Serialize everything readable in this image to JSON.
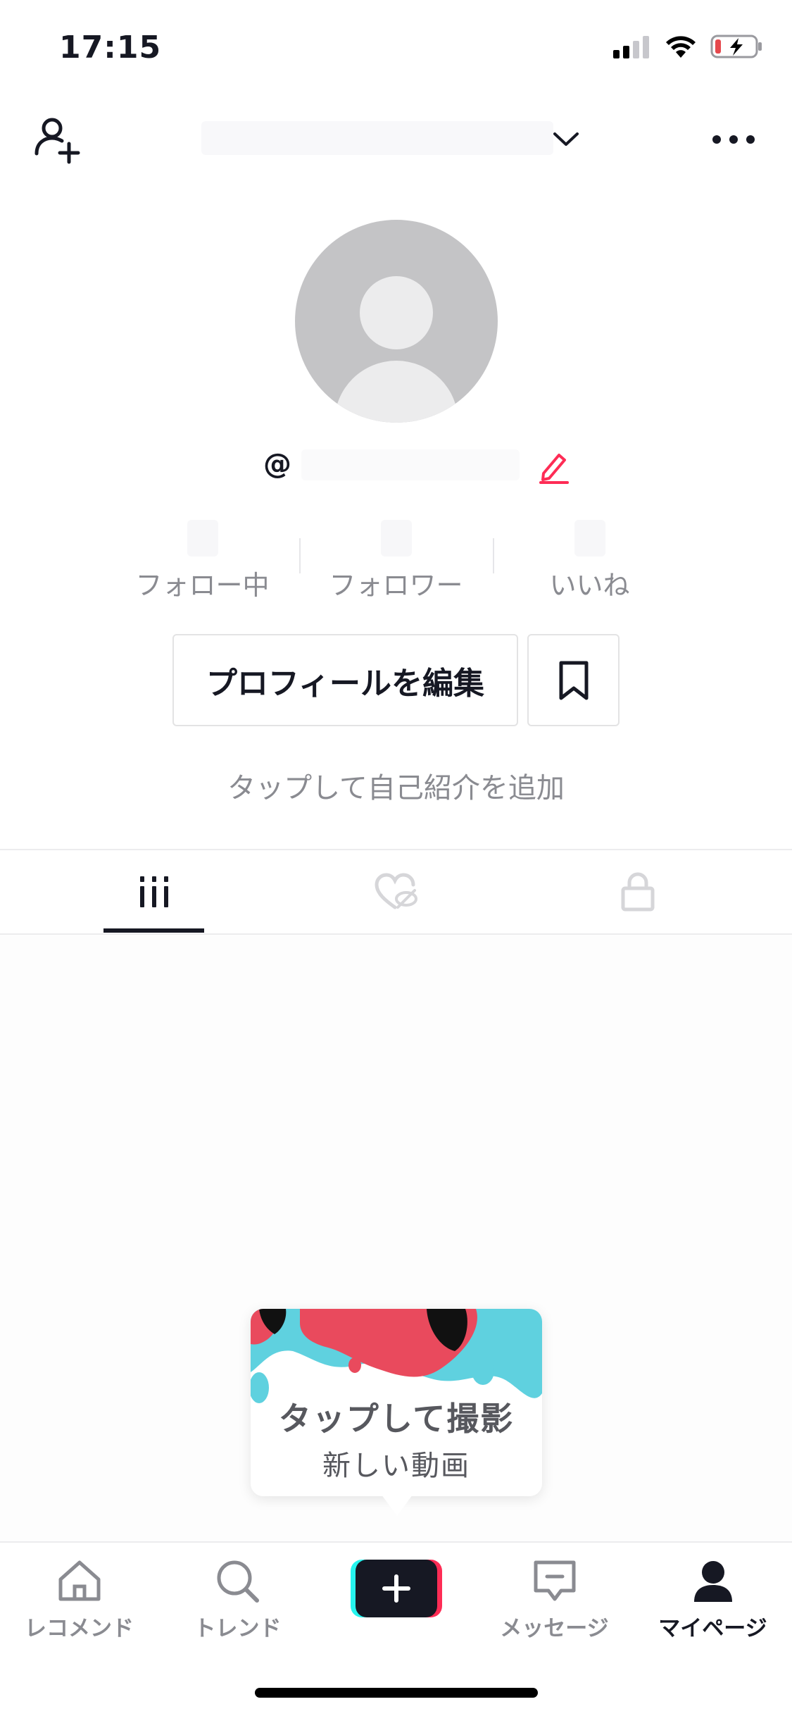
{
  "status_bar": {
    "time": "17:15",
    "battery_color": "#e5484d"
  },
  "top_bar": {
    "chevron_icon": "chevron-down-icon",
    "more_icon": "more-horizontal-icon"
  },
  "profile": {
    "handle_prefix": "@"
  },
  "stats": [
    {
      "label": "フォロー中"
    },
    {
      "label": "フォロワー"
    },
    {
      "label": "いいね"
    }
  ],
  "buttons": {
    "edit_profile": "プロフィールを編集"
  },
  "bio_placeholder": "タップして自己紹介を追加",
  "tabs": [
    {
      "name": "videos",
      "icon": "grid-icon",
      "active": true
    },
    {
      "name": "liked",
      "icon": "hidden-heart-icon",
      "active": false
    },
    {
      "name": "private",
      "icon": "lock-icon",
      "active": false
    }
  ],
  "tooltip": {
    "title": "タップして撮影",
    "subtitle": "新しい動画"
  },
  "nav": {
    "items": [
      {
        "label": "レコメンド",
        "icon": "home-icon"
      },
      {
        "label": "トレンド",
        "icon": "search-icon"
      },
      {
        "label": "",
        "icon": "plus-icon"
      },
      {
        "label": "メッセージ",
        "icon": "message-icon"
      },
      {
        "label": "マイページ",
        "icon": "profile-icon"
      }
    ]
  },
  "colors": {
    "accent": "#fe2c55",
    "cyan": "#25f4ee",
    "text": "#161823",
    "muted": "#8a8b91"
  }
}
